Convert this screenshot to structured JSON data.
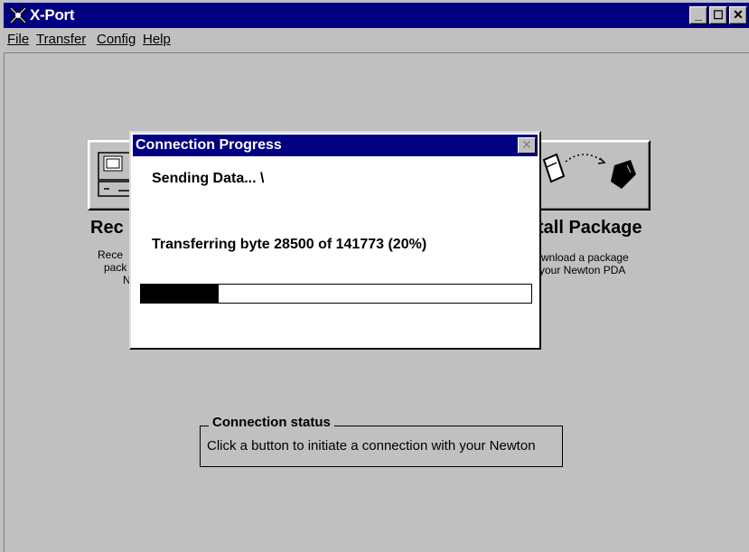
{
  "window": {
    "title": "X-Port"
  },
  "menu": [
    "File",
    "Transfer",
    "Config",
    "Help"
  ],
  "features": {
    "receive": {
      "title": "Rec",
      "desc_lines": [
        "Rece",
        "pack",
        "N"
      ]
    },
    "install": {
      "title": "tall Package",
      "desc_lines": [
        "wnload a package",
        "your Newton PDA"
      ]
    }
  },
  "status": {
    "legend": "Connection status",
    "text": "Click a button to initiate a connection with your Newton"
  },
  "dialog": {
    "title": "Connection Progress",
    "sending": "Sending Data...  \\",
    "bytes": "Transferring byte 28500 of 141773 (20%)",
    "progress_fraction": 0.2
  },
  "colors": {
    "titlebar": "#000080",
    "face": "#c0c0c0"
  },
  "icons": {
    "app": "x-port-app-icon",
    "close": "close-icon",
    "minimize": "minimize-icon",
    "maximize": "maximize-icon"
  }
}
